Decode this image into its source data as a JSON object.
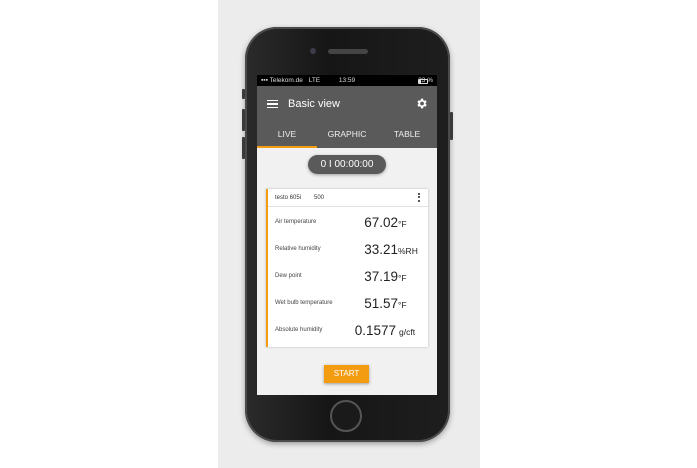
{
  "status_bar": {
    "carrier": "Telekom.de",
    "network": "LTE",
    "time": "13:59",
    "battery": "23 %",
    "battery_level": 0.23
  },
  "app_bar": {
    "title": "Basic view",
    "menu_icon": "hamburger-menu-icon",
    "settings_icon": "gear-icon"
  },
  "tabs": [
    {
      "label": "LIVE",
      "active": true
    },
    {
      "label": "GRAPHIC",
      "active": false
    },
    {
      "label": "TABLE",
      "active": false
    }
  ],
  "timer": "0 I 00:00:00",
  "card": {
    "device": "testo 605i",
    "serial": "500",
    "readings": [
      {
        "label": "Air temperature",
        "value": "67.02",
        "unit": "°F"
      },
      {
        "label": "Relative humidity",
        "value": "33.21",
        "unit": "%RH"
      },
      {
        "label": "Dew point",
        "value": "37.19",
        "unit": "°F"
      },
      {
        "label": "Wet bulb temperature",
        "value": "51.57",
        "unit": "°F"
      },
      {
        "label": "Absolute humidity",
        "value": "0.1577",
        "unit": "g/cft"
      }
    ]
  },
  "start_button": "START",
  "colors": {
    "accent": "#f39c12",
    "app_bar": "#5a5a5a",
    "background": "#f1f1f1"
  }
}
